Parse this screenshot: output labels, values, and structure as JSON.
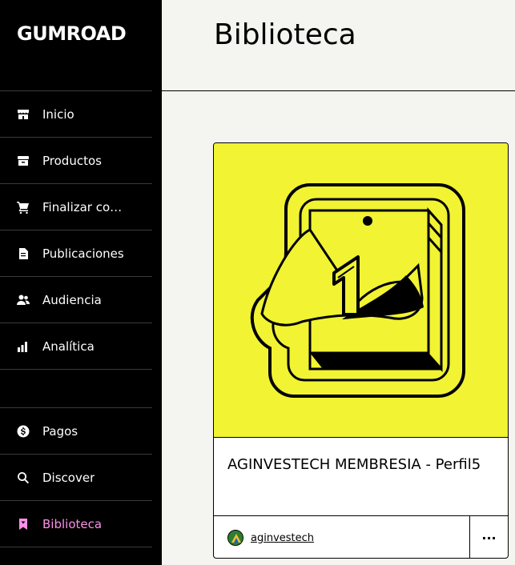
{
  "sidebar": {
    "logo": "GUMROAD",
    "items": [
      {
        "label": "Inicio",
        "icon": "store-icon"
      },
      {
        "label": "Productos",
        "icon": "archive-icon"
      },
      {
        "label": "Finalizar compra",
        "icon": "cart-icon"
      },
      {
        "label": "Publicaciones",
        "icon": "document-icon"
      },
      {
        "label": "Audiencia",
        "icon": "people-icon"
      },
      {
        "label": "Analítica",
        "icon": "bar-chart-icon"
      },
      {
        "label": "Pagos",
        "icon": "dollar-icon"
      },
      {
        "label": "Discover",
        "icon": "search-icon"
      },
      {
        "label": "Biblioteca",
        "icon": "bookmark-icon"
      }
    ],
    "active": "Biblioteca",
    "active_color": "#ff90e8"
  },
  "header": {
    "title": "Biblioteca"
  },
  "card": {
    "title": "AGINVESTECH MEMBRESIA - Perfil5",
    "creator": "aginvestech",
    "more_label": "···",
    "thumb_color": "#f1f333"
  }
}
